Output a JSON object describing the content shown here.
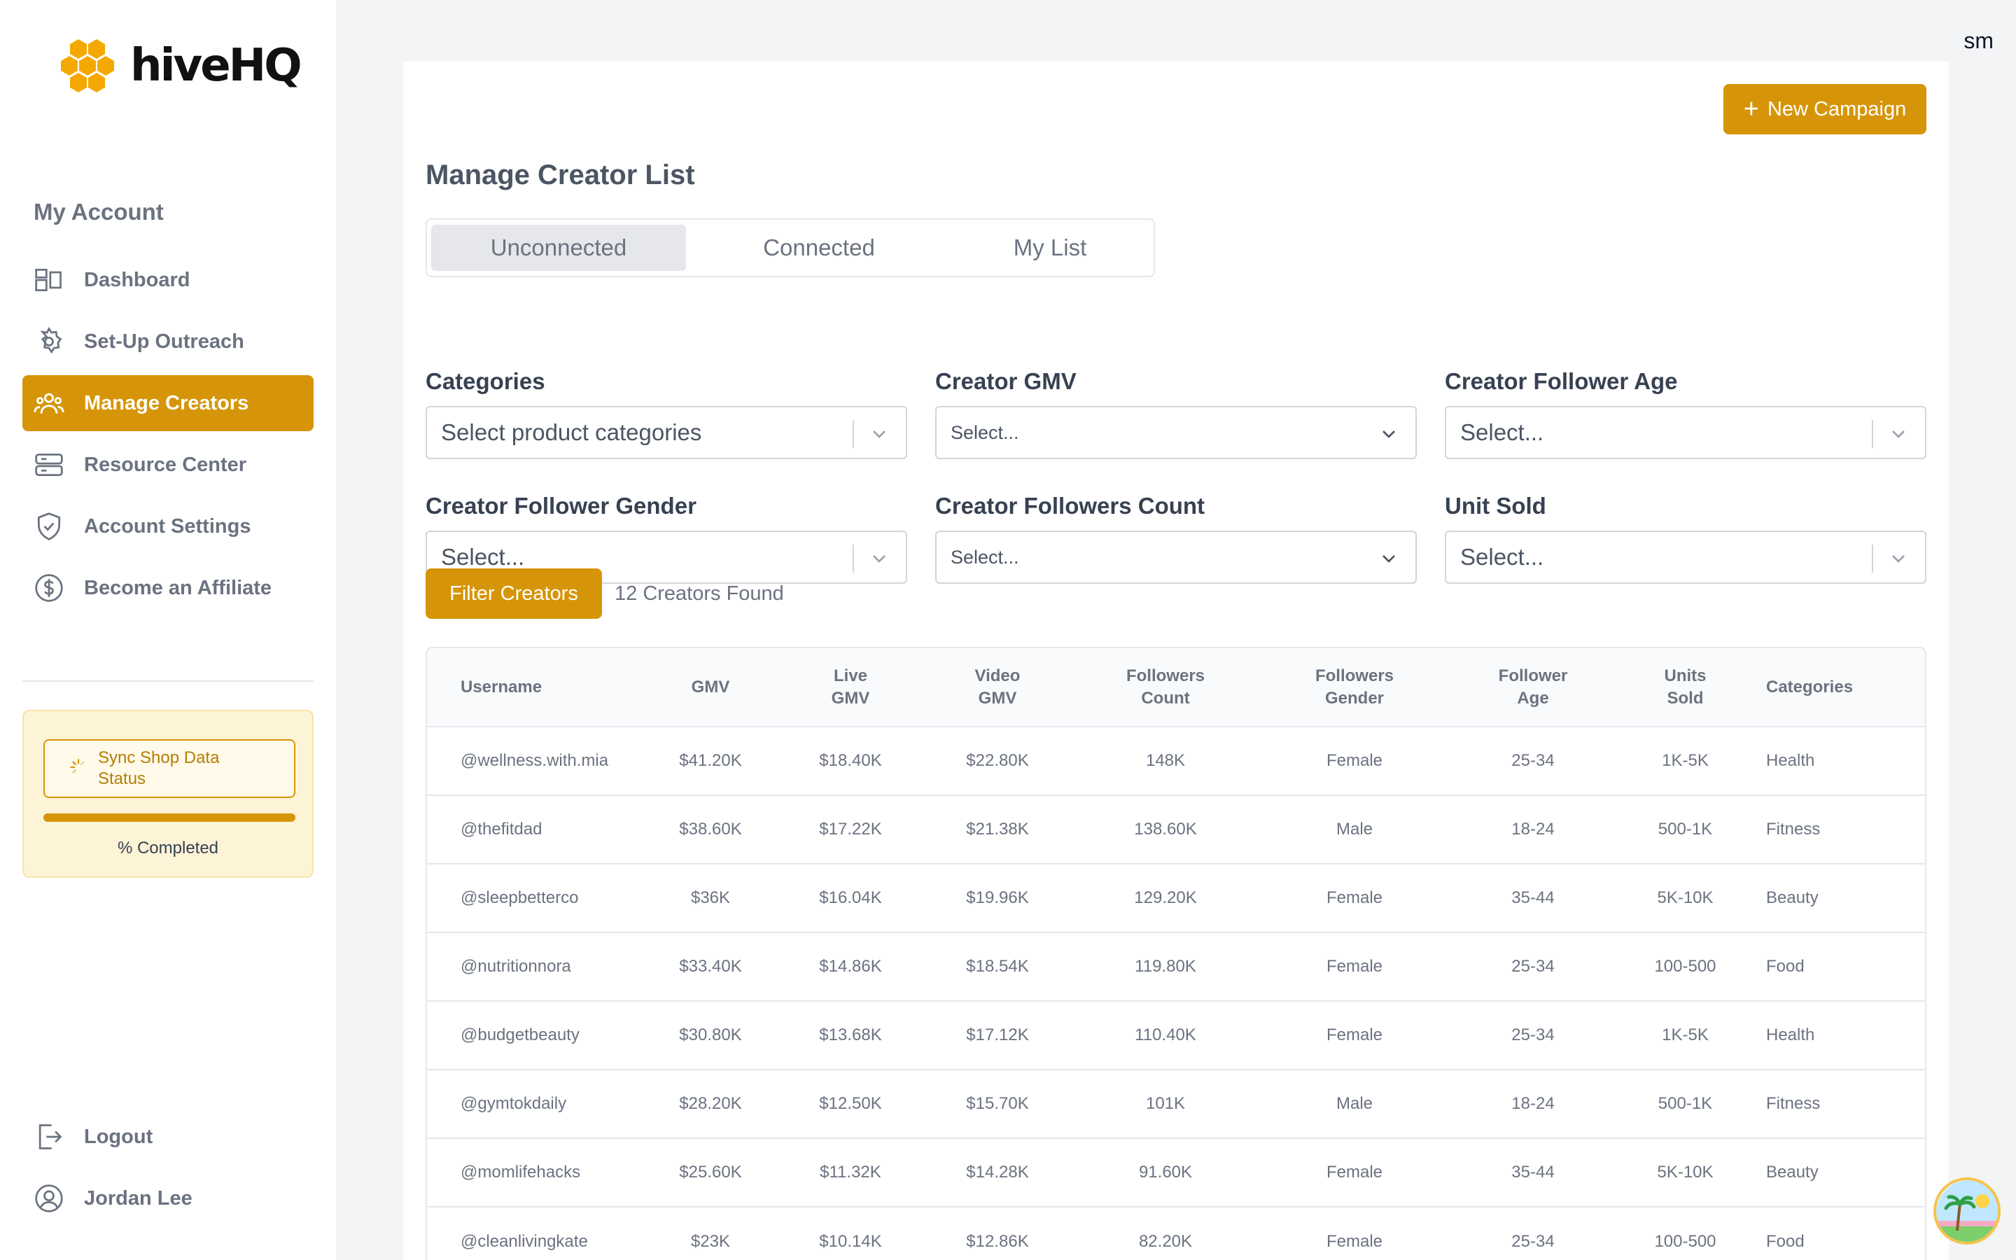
{
  "brand": {
    "name": "hiveHQ",
    "accent": "#d69508"
  },
  "user_corner": "sm",
  "sidebar": {
    "section_title": "My Account",
    "items": [
      {
        "label": "Dashboard",
        "icon": "dashboard-icon"
      },
      {
        "label": "Set-Up Outreach",
        "icon": "gear-icon"
      },
      {
        "label": "Manage Creators",
        "icon": "users-icon",
        "active": true
      },
      {
        "label": "Resource Center",
        "icon": "server-icon"
      },
      {
        "label": "Account Settings",
        "icon": "shield-icon"
      },
      {
        "label": "Become an Affiliate",
        "icon": "dollar-icon"
      }
    ],
    "sync": {
      "label": "Sync Shop Data Status",
      "progress_text": "% Completed",
      "progress": 100
    },
    "bottom": [
      {
        "label": "Logout",
        "icon": "logout-icon"
      },
      {
        "label": "Jordan Lee",
        "icon": "user-icon"
      }
    ]
  },
  "main": {
    "new_campaign_label": "New Campaign",
    "title": "Manage Creator List",
    "tabs": [
      {
        "label": "Unconnected",
        "active": true
      },
      {
        "label": "Connected"
      },
      {
        "label": "My List"
      }
    ],
    "filters": [
      {
        "label": "Categories",
        "placeholder": "Select product categories"
      },
      {
        "label": "Creator GMV",
        "placeholder": "Select..."
      },
      {
        "label": "Creator Follower Age",
        "placeholder": "Select..."
      },
      {
        "label": "Creator Follower Gender",
        "placeholder": "Select..."
      },
      {
        "label": "Creator Followers Count",
        "placeholder": "Select..."
      },
      {
        "label": "Unit Sold",
        "placeholder": "Select..."
      }
    ],
    "filter_button": "Filter Creators",
    "found_text": "12 Creators Found",
    "table": {
      "headers": [
        [
          "Username"
        ],
        [
          "GMV"
        ],
        [
          "Live",
          "GMV"
        ],
        [
          "Video",
          "GMV"
        ],
        [
          "Followers",
          "Count"
        ],
        [
          "Followers",
          "Gender"
        ],
        [
          "Follower",
          "Age"
        ],
        [
          "Units",
          "Sold"
        ],
        [
          "Categories"
        ]
      ],
      "rows": [
        [
          "@wellness.with.mia",
          "$41.20K",
          "$18.40K",
          "$22.80K",
          "148K",
          "Female",
          "25-34",
          "1K-5K",
          "Health"
        ],
        [
          "@thefitdad",
          "$38.60K",
          "$17.22K",
          "$21.38K",
          "138.60K",
          "Male",
          "18-24",
          "500-1K",
          "Fitness"
        ],
        [
          "@sleepbetterco",
          "$36K",
          "$16.04K",
          "$19.96K",
          "129.20K",
          "Female",
          "35-44",
          "5K-10K",
          "Beauty"
        ],
        [
          "@nutritionnora",
          "$33.40K",
          "$14.86K",
          "$18.54K",
          "119.80K",
          "Female",
          "25-34",
          "100-500",
          "Food"
        ],
        [
          "@budgetbeauty",
          "$30.80K",
          "$13.68K",
          "$17.12K",
          "110.40K",
          "Female",
          "25-34",
          "1K-5K",
          "Health"
        ],
        [
          "@gymtokdaily",
          "$28.20K",
          "$12.50K",
          "$15.70K",
          "101K",
          "Male",
          "18-24",
          "500-1K",
          "Fitness"
        ],
        [
          "@momlifehacks",
          "$25.60K",
          "$11.32K",
          "$14.28K",
          "91.60K",
          "Female",
          "35-44",
          "5K-10K",
          "Beauty"
        ],
        [
          "@cleanlivingkate",
          "$23K",
          "$10.14K",
          "$12.86K",
          "82.20K",
          "Female",
          "25-34",
          "100-500",
          "Food"
        ]
      ]
    }
  }
}
